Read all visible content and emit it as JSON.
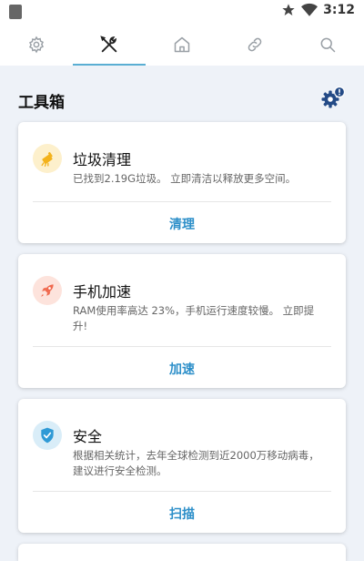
{
  "status_bar": {
    "time": "3:12"
  },
  "tabs": [
    {
      "name": "settings",
      "icon": "gear-icon"
    },
    {
      "name": "tools",
      "icon": "tools-icon",
      "active": true
    },
    {
      "name": "home",
      "icon": "home-icon"
    },
    {
      "name": "link",
      "icon": "link-icon"
    },
    {
      "name": "search",
      "icon": "search-icon"
    }
  ],
  "section": {
    "title": "工具箱"
  },
  "cards": [
    {
      "title": "垃圾清理",
      "description": "已找到2.19G垃圾。 立即清洁以释放更多空间。",
      "action": "清理",
      "icon": "broom-icon",
      "icon_color": "#f3b21b",
      "icon_bg": "#fdf0cc"
    },
    {
      "title": "手机加速",
      "description": "RAM使用率高达 23%，手机运行速度较慢。 立即提升!",
      "action": "加速",
      "icon": "rocket-icon",
      "icon_color": "#f06a4f",
      "icon_bg": "#fde3dc"
    },
    {
      "title": "安全",
      "description": "根据相关统计，去年全球检测到近2000万移动病毒，建议进行安全检测。",
      "action": "扫描",
      "icon": "shield-icon",
      "icon_color": "#2f9ad6",
      "icon_bg": "#d9edf8"
    }
  ],
  "colors": {
    "accent": "#2d8fc9",
    "tab_indicator": "#5aaed3",
    "background": "#eef2f8"
  }
}
